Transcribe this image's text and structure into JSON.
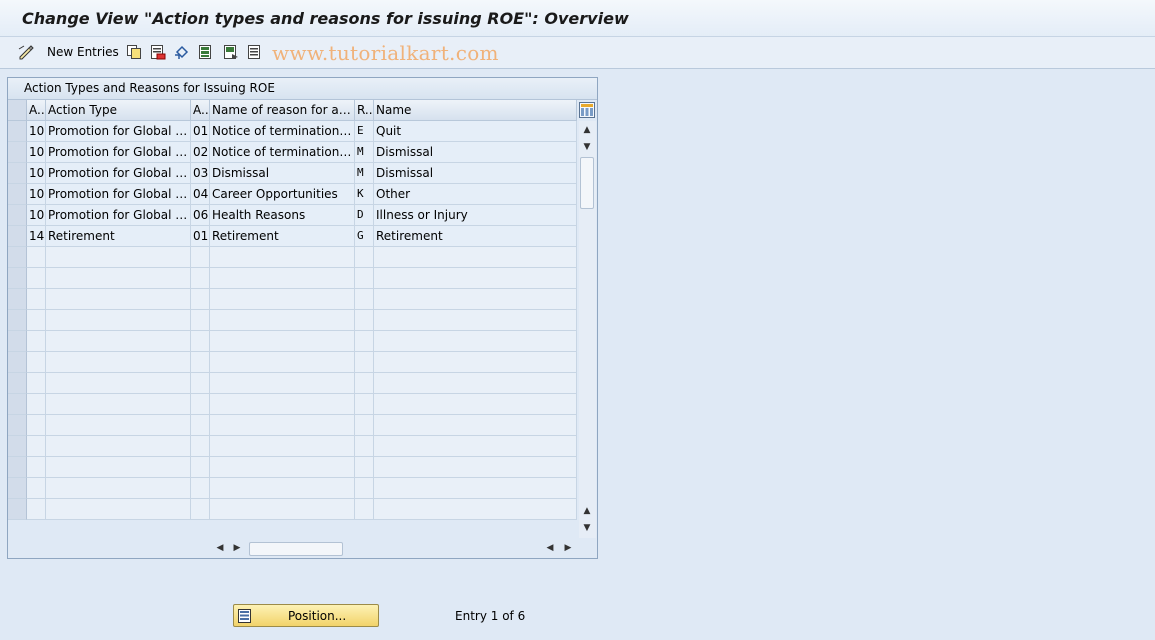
{
  "window": {
    "title": "Change View \"Action types and reasons for issuing ROE\": Overview"
  },
  "toolbar": {
    "new_entries_label": "New Entries",
    "icons": [
      "edit-icon",
      "copy-icon",
      "delete-icon",
      "undo-icon",
      "select-all-icon",
      "select-block-icon",
      "deselect-all-icon"
    ]
  },
  "watermark": "www.tutorialkart.com",
  "table": {
    "caption": "Action Types and Reasons for Issuing ROE",
    "columns": [
      "A..",
      "Action Type",
      "A..",
      "Name of reason for acti...",
      "R..",
      "Name"
    ],
    "rows": [
      [
        "10",
        "Promotion for Global Trin...",
        "01",
        "Notice of termination by ...",
        "E",
        "Quit"
      ],
      [
        "10",
        "Promotion for Global Trin...",
        "02",
        "Notice of termination by ...",
        "M",
        "Dismissal"
      ],
      [
        "10",
        "Promotion for Global Trin...",
        "03",
        "Dismissal",
        "M",
        "Dismissal"
      ],
      [
        "10",
        "Promotion for Global Trin...",
        "04",
        "Career Opportunities",
        "K",
        "Other"
      ],
      [
        "10",
        "Promotion for Global Trin...",
        "06",
        "Health Reasons",
        "D",
        "Illness or Injury"
      ],
      [
        "14",
        "Retirement",
        "01",
        "Retirement",
        "G",
        "Retirement"
      ]
    ]
  },
  "footer": {
    "position_button": "Position...",
    "entry_status": "Entry 1 of 6"
  }
}
